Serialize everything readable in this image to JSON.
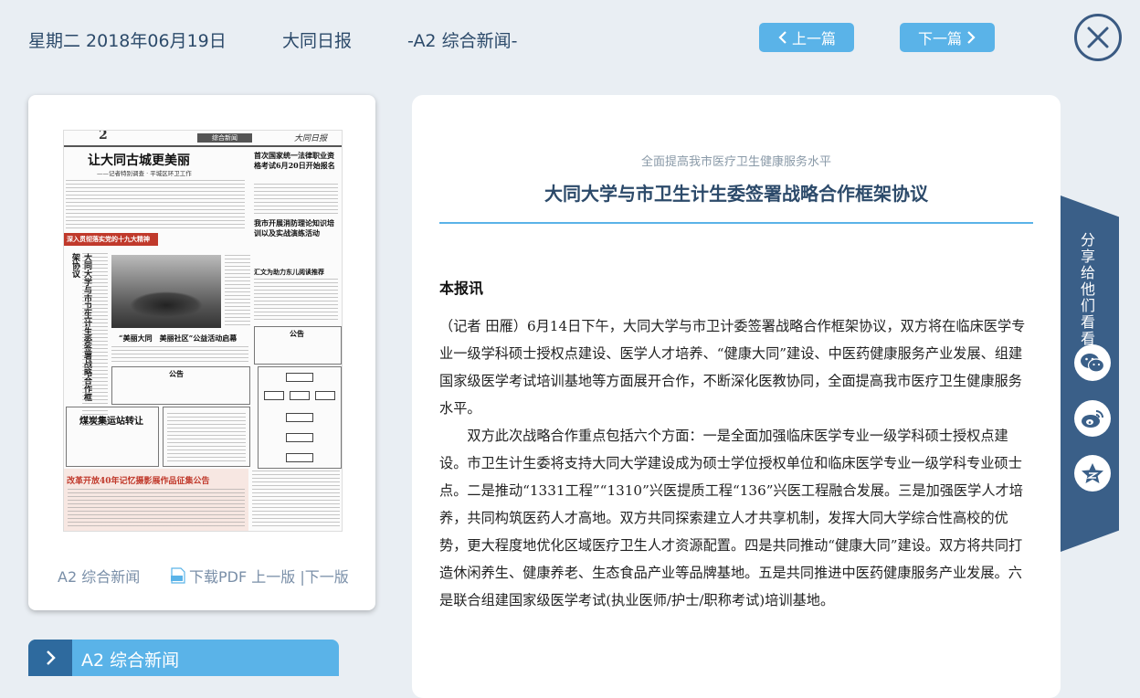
{
  "header": {
    "date": "星期二 2018年06月19日",
    "paper": "大同日报",
    "section": "-A2 综合新闻-",
    "prev_label": "上一篇",
    "next_label": "下一篇",
    "icons": {
      "prev": "chevron-left-icon",
      "next": "chevron-right-icon",
      "close": "close-icon"
    }
  },
  "page_card": {
    "thumbnail": {
      "page_number": "2",
      "section_tag": "综合新闻",
      "masthead": "大同日报",
      "headline": "让大同古城更美丽",
      "subheadline": "——记者特别调查 · 平城区环卫工作",
      "banner": "深入贯彻落实党的十九大精神",
      "vertical_headline": "大同大学与市卫生计生委签署战略合作框架协议",
      "headline_right_1": "首次国家统一法律职业资格考试6月20日开始报名",
      "headline_right_2": "我市开展消防理论知识培训以及实战演练活动",
      "headline_right_3": "汇文为助力东儿阅读推荐",
      "photo_caption": "“美丽大同　美丽社区”公益活动启幕",
      "notice_1": "公告",
      "notice_2": "公告",
      "box_head": "煤炭集运站转让",
      "ad_head": "改革开放40年记忆摄影展作品征集公告"
    },
    "footer_section": "A2 综合新闻",
    "footer_download": "下载PDF 上一版 |下一版"
  },
  "section_bar": {
    "label": "A2  综合新闻"
  },
  "article": {
    "kicker": "全面提高我市医疗卫生健康服务水平",
    "title": "大同大学与市卫生计生委签署战略合作框架协议",
    "lead": "本报讯",
    "paragraphs": [
      "（记者 田雁）6月14日下午，大同大学与市卫计委签署战略合作框架协议，双方将在临床医学专业一级学科硕士授权点建设、医学人才培养、“健康大同”建设、中医药健康服务产业发展、组建国家级医学考试培训基地等方面展开合作，不断深化医教协同，全面提高我市医疗卫生健康服务水平。",
      "双方此次战略合作重点包括六个方面：一是全面加强临床医学专业一级学科硕士授权点建设。市卫生计生委将支持大同大学建设成为硕士学位授权单位和临床医学专业一级学科专业硕士点。二是推动“1331工程”“1310”兴医提质工程“136”兴医工程融合发展。三是加强医学人才培养，共同构筑医药人才高地。双方共同探索建立人才共享机制，发挥大同大学综合性高校的优势，更大程度地优化区域医疗卫生人才资源配置。四是共同推动“健康大同”建设。双方将共同打造休闲养生、健康养老、生态食品产业等品牌基地。五是共同推进中医药健康服务产业发展。六是联合组建国家级医学考试(执业医师/护士/职称考试)培训基地。"
    ]
  },
  "share": {
    "label": "分享给他们看看",
    "icons": [
      "wechat-icon",
      "weibo-icon",
      "favorite-star-icon"
    ]
  },
  "colors": {
    "background": "#e9eef3",
    "accent": "#5ab3e8",
    "dark_blue": "#2c4a6a",
    "share_panel": "#3a5f88"
  }
}
